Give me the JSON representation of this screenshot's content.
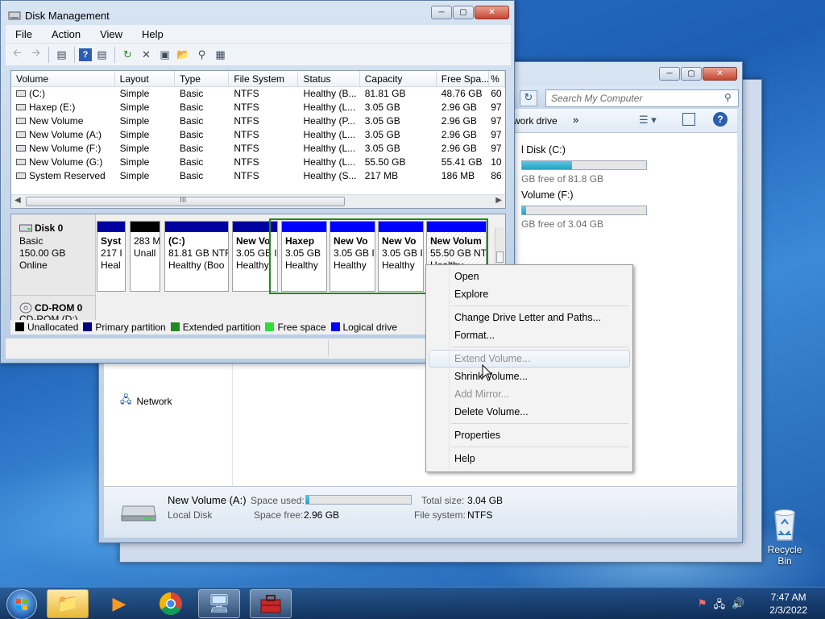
{
  "disk_management": {
    "title": "Disk Management",
    "menu": [
      "File",
      "Action",
      "View",
      "Help"
    ],
    "columns": [
      "Volume",
      "Layout",
      "Type",
      "File System",
      "Status",
      "Capacity",
      "Free Spa...",
      "%"
    ],
    "volumes": [
      {
        "volume": "(C:)",
        "layout": "Simple",
        "type": "Basic",
        "fs": "NTFS",
        "status": "Healthy (B...",
        "capacity": "81.81 GB",
        "free": "48.76 GB",
        "pct": "60"
      },
      {
        "volume": "Haxep (E:)",
        "layout": "Simple",
        "type": "Basic",
        "fs": "NTFS",
        "status": "Healthy (L...",
        "capacity": "3.05 GB",
        "free": "2.96 GB",
        "pct": "97"
      },
      {
        "volume": "New Volume",
        "layout": "Simple",
        "type": "Basic",
        "fs": "NTFS",
        "status": "Healthy (P...",
        "capacity": "3.05 GB",
        "free": "2.96 GB",
        "pct": "97"
      },
      {
        "volume": "New Volume (A:)",
        "layout": "Simple",
        "type": "Basic",
        "fs": "NTFS",
        "status": "Healthy (L...",
        "capacity": "3.05 GB",
        "free": "2.96 GB",
        "pct": "97"
      },
      {
        "volume": "New Volume (F:)",
        "layout": "Simple",
        "type": "Basic",
        "fs": "NTFS",
        "status": "Healthy (L...",
        "capacity": "3.05 GB",
        "free": "2.96 GB",
        "pct": "97"
      },
      {
        "volume": "New Volume (G:)",
        "layout": "Simple",
        "type": "Basic",
        "fs": "NTFS",
        "status": "Healthy (L...",
        "capacity": "55.50 GB",
        "free": "55.41 GB",
        "pct": "10"
      },
      {
        "volume": "System Reserved",
        "layout": "Simple",
        "type": "Basic",
        "fs": "NTFS",
        "status": "Healthy (S...",
        "capacity": "217 MB",
        "free": "186 MB",
        "pct": "86"
      }
    ],
    "scroll_grip": "III",
    "disk0": {
      "name": "Disk 0",
      "type": "Basic",
      "size": "150.00 GB",
      "state": "Online"
    },
    "partitions": [
      {
        "l1": "Syst",
        "l2": "217 I",
        "l3": "Heal",
        "color": "#0000a0"
      },
      {
        "l1": "",
        "l2": "283 M",
        "l3": "Unall",
        "color": "#000000"
      },
      {
        "l1": "(C:)",
        "l2": "81.81 GB NTF",
        "l3": "Healthy (Boo",
        "color": "#0000a0"
      },
      {
        "l1": "New Vo",
        "l2": "3.05 GB I",
        "l3": "Healthy",
        "color": "#0000a0"
      },
      {
        "l1": "Haxep",
        "l2": "3.05 GB",
        "l3": "Healthy",
        "color": "#0000ff"
      },
      {
        "l1": "New Vo",
        "l2": "3.05 GB I",
        "l3": "Healthy",
        "color": "#0000ff"
      },
      {
        "l1": "New Vo",
        "l2": "3.05 GB I",
        "l3": "Healthy",
        "color": "#0000ff"
      },
      {
        "l1": "New Volum",
        "l2": "55.50 GB NT",
        "l3": "Healthy",
        "color": "#0000ff"
      }
    ],
    "cdrom": {
      "name": "CD-ROM 0",
      "sub": "CD-ROM (D:)"
    },
    "legend": [
      {
        "label": "Unallocated",
        "color": "#000000"
      },
      {
        "label": "Primary partition",
        "color": "#000080"
      },
      {
        "label": "Extended partition",
        "color": "#1f8a1f"
      },
      {
        "label": "Free space",
        "color": "#33dd33"
      },
      {
        "label": "Logical drive",
        "color": "#0000ff"
      }
    ]
  },
  "context_menu": {
    "items": [
      {
        "label": "Open",
        "disabled": false
      },
      {
        "label": "Explore",
        "disabled": false
      },
      {
        "sep": true
      },
      {
        "label": "Change Drive Letter and Paths...",
        "disabled": false
      },
      {
        "label": "Format...",
        "disabled": false
      },
      {
        "sep": true
      },
      {
        "label": "Extend Volume...",
        "disabled": true,
        "hover": true
      },
      {
        "label": "Shrink Volume...",
        "disabled": false
      },
      {
        "label": "Add Mirror...",
        "disabled": true
      },
      {
        "label": "Delete Volume...",
        "disabled": false
      },
      {
        "sep": true
      },
      {
        "label": "Properties",
        "disabled": false
      },
      {
        "sep": true
      },
      {
        "label": "Help",
        "disabled": false
      }
    ]
  },
  "explorer": {
    "search_placeholder": "Search My Computer",
    "cmd_text": "work drive",
    "drives": [
      {
        "name": "l Disk (C:)",
        "free_text": "GB free of 81.8 GB",
        "used_fraction": 0.4
      },
      {
        "name": "Volume (F:)",
        "free_text": "GB free of 3.04 GB",
        "used_fraction": 0.03
      }
    ],
    "nav_network": "Network",
    "details": {
      "name": "New Volume (A:)",
      "kind": "Local Disk",
      "space_used_label": "Space used:",
      "space_free_label": "Space free:",
      "space_free": "2.96 GB",
      "total_size_label": "Total size:",
      "total_size": "3.04 GB",
      "fs_label": "File system:",
      "fs": "NTFS",
      "used_fraction": 0.03
    }
  },
  "desktop": {
    "recycle_bin": "Recycle Bin"
  },
  "taskbar": {
    "time": "7:47 AM",
    "date": "2/3/2022"
  }
}
